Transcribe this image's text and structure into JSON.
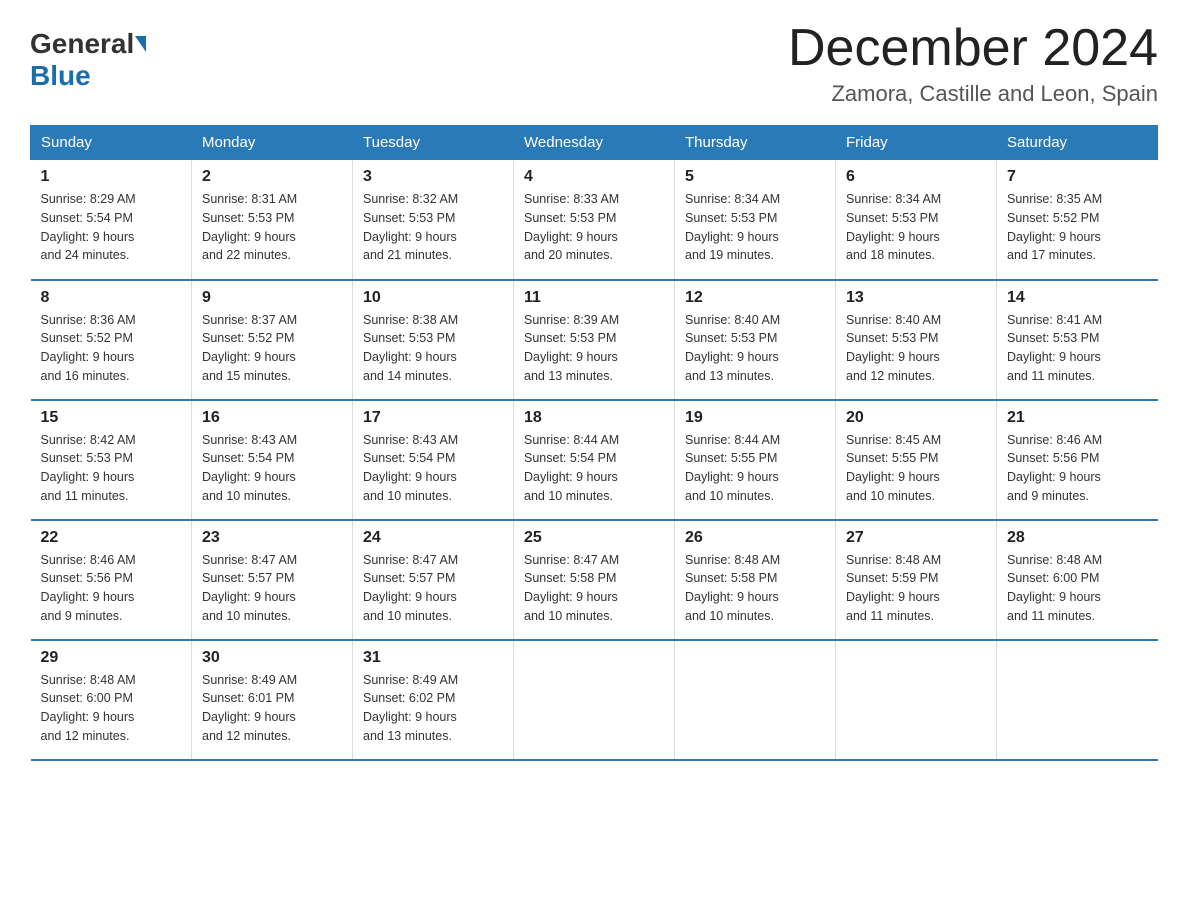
{
  "header": {
    "logo_general": "General",
    "logo_blue": "Blue",
    "month_title": "December 2024",
    "subtitle": "Zamora, Castille and Leon, Spain"
  },
  "days_of_week": [
    "Sunday",
    "Monday",
    "Tuesday",
    "Wednesday",
    "Thursday",
    "Friday",
    "Saturday"
  ],
  "weeks": [
    [
      {
        "day": "1",
        "sunrise": "8:29 AM",
        "sunset": "5:54 PM",
        "daylight": "9 hours and 24 minutes."
      },
      {
        "day": "2",
        "sunrise": "8:31 AM",
        "sunset": "5:53 PM",
        "daylight": "9 hours and 22 minutes."
      },
      {
        "day": "3",
        "sunrise": "8:32 AM",
        "sunset": "5:53 PM",
        "daylight": "9 hours and 21 minutes."
      },
      {
        "day": "4",
        "sunrise": "8:33 AM",
        "sunset": "5:53 PM",
        "daylight": "9 hours and 20 minutes."
      },
      {
        "day": "5",
        "sunrise": "8:34 AM",
        "sunset": "5:53 PM",
        "daylight": "9 hours and 19 minutes."
      },
      {
        "day": "6",
        "sunrise": "8:34 AM",
        "sunset": "5:53 PM",
        "daylight": "9 hours and 18 minutes."
      },
      {
        "day": "7",
        "sunrise": "8:35 AM",
        "sunset": "5:52 PM",
        "daylight": "9 hours and 17 minutes."
      }
    ],
    [
      {
        "day": "8",
        "sunrise": "8:36 AM",
        "sunset": "5:52 PM",
        "daylight": "9 hours and 16 minutes."
      },
      {
        "day": "9",
        "sunrise": "8:37 AM",
        "sunset": "5:52 PM",
        "daylight": "9 hours and 15 minutes."
      },
      {
        "day": "10",
        "sunrise": "8:38 AM",
        "sunset": "5:53 PM",
        "daylight": "9 hours and 14 minutes."
      },
      {
        "day": "11",
        "sunrise": "8:39 AM",
        "sunset": "5:53 PM",
        "daylight": "9 hours and 13 minutes."
      },
      {
        "day": "12",
        "sunrise": "8:40 AM",
        "sunset": "5:53 PM",
        "daylight": "9 hours and 13 minutes."
      },
      {
        "day": "13",
        "sunrise": "8:40 AM",
        "sunset": "5:53 PM",
        "daylight": "9 hours and 12 minutes."
      },
      {
        "day": "14",
        "sunrise": "8:41 AM",
        "sunset": "5:53 PM",
        "daylight": "9 hours and 11 minutes."
      }
    ],
    [
      {
        "day": "15",
        "sunrise": "8:42 AM",
        "sunset": "5:53 PM",
        "daylight": "9 hours and 11 minutes."
      },
      {
        "day": "16",
        "sunrise": "8:43 AM",
        "sunset": "5:54 PM",
        "daylight": "9 hours and 10 minutes."
      },
      {
        "day": "17",
        "sunrise": "8:43 AM",
        "sunset": "5:54 PM",
        "daylight": "9 hours and 10 minutes."
      },
      {
        "day": "18",
        "sunrise": "8:44 AM",
        "sunset": "5:54 PM",
        "daylight": "9 hours and 10 minutes."
      },
      {
        "day": "19",
        "sunrise": "8:44 AM",
        "sunset": "5:55 PM",
        "daylight": "9 hours and 10 minutes."
      },
      {
        "day": "20",
        "sunrise": "8:45 AM",
        "sunset": "5:55 PM",
        "daylight": "9 hours and 10 minutes."
      },
      {
        "day": "21",
        "sunrise": "8:46 AM",
        "sunset": "5:56 PM",
        "daylight": "9 hours and 9 minutes."
      }
    ],
    [
      {
        "day": "22",
        "sunrise": "8:46 AM",
        "sunset": "5:56 PM",
        "daylight": "9 hours and 9 minutes."
      },
      {
        "day": "23",
        "sunrise": "8:47 AM",
        "sunset": "5:57 PM",
        "daylight": "9 hours and 10 minutes."
      },
      {
        "day": "24",
        "sunrise": "8:47 AM",
        "sunset": "5:57 PM",
        "daylight": "9 hours and 10 minutes."
      },
      {
        "day": "25",
        "sunrise": "8:47 AM",
        "sunset": "5:58 PM",
        "daylight": "9 hours and 10 minutes."
      },
      {
        "day": "26",
        "sunrise": "8:48 AM",
        "sunset": "5:58 PM",
        "daylight": "9 hours and 10 minutes."
      },
      {
        "day": "27",
        "sunrise": "8:48 AM",
        "sunset": "5:59 PM",
        "daylight": "9 hours and 11 minutes."
      },
      {
        "day": "28",
        "sunrise": "8:48 AM",
        "sunset": "6:00 PM",
        "daylight": "9 hours and 11 minutes."
      }
    ],
    [
      {
        "day": "29",
        "sunrise": "8:48 AM",
        "sunset": "6:00 PM",
        "daylight": "9 hours and 12 minutes."
      },
      {
        "day": "30",
        "sunrise": "8:49 AM",
        "sunset": "6:01 PM",
        "daylight": "9 hours and 12 minutes."
      },
      {
        "day": "31",
        "sunrise": "8:49 AM",
        "sunset": "6:02 PM",
        "daylight": "9 hours and 13 minutes."
      },
      null,
      null,
      null,
      null
    ]
  ],
  "labels": {
    "sunrise": "Sunrise:",
    "sunset": "Sunset:",
    "daylight": "Daylight:"
  }
}
